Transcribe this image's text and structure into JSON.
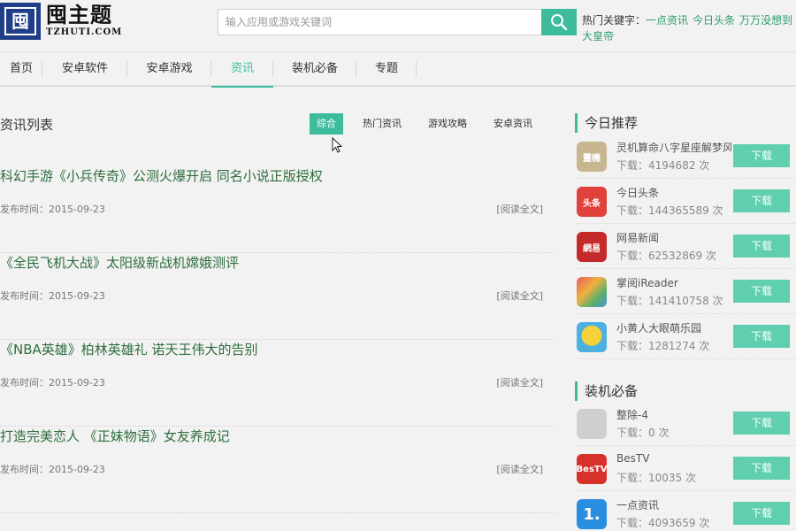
{
  "site": {
    "logo_glyph": "囤",
    "name": "囤主题",
    "domain": "TZHUTI.COM"
  },
  "search": {
    "placeholder": "输入应用或游戏关键词"
  },
  "hot": {
    "label": "热门关键字：",
    "keywords": [
      "一点资讯",
      "今日头条",
      "万万没想到",
      "大皇帝"
    ]
  },
  "nav": [
    "首页",
    "安卓软件",
    "安卓游戏",
    "资讯",
    "装机必备",
    "专题"
  ],
  "nav_active_index": 3,
  "list": {
    "title": "资讯列表",
    "filters": [
      "综合",
      "热门资讯",
      "游戏攻略",
      "安卓资讯"
    ],
    "active_filter": 0,
    "date_prefix": "发布时间：",
    "read_label": "[阅读全文]",
    "articles": [
      {
        "title": "科幻手游《小兵传奇》公测火爆开启 同名小说正版授权",
        "date": "2015-09-23"
      },
      {
        "title": "《全民飞机大战》太阳级新战机嫦娥测评",
        "date": "2015-09-23"
      },
      {
        "title": "《NBA英雄》柏林英雄礼 诺天王伟大的告别",
        "date": "2015-09-23"
      },
      {
        "title": "打造完美恋人 《正妹物语》女友养成记",
        "date": "2015-09-23"
      }
    ]
  },
  "sidebar": {
    "dl_label": "下载：",
    "dl_unit": " 次",
    "button_label": "下载",
    "today": {
      "title": "今日推荐",
      "apps": [
        {
          "name": "灵机算命八字星座解梦风水",
          "downloads": "4194682",
          "icon": "lingji-icon",
          "color": "#c8b690",
          "glyph": "靈機"
        },
        {
          "name": "今日头条",
          "downloads": "144365589",
          "icon": "toutiao-icon",
          "color": "#e0413a",
          "glyph": "头条"
        },
        {
          "name": "网易新闻",
          "downloads": "62532869",
          "icon": "netease-news-icon",
          "color": "#c42a2a",
          "glyph": "網易"
        },
        {
          "name": "掌阅iReader",
          "downloads": "141410758",
          "icon": "ireader-icon",
          "color": "#e37a3a",
          "glyph": ""
        },
        {
          "name": "小黄人大眼萌乐园",
          "downloads": "1281274",
          "icon": "minion-icon",
          "color": "#4cb0e0",
          "glyph": ""
        }
      ]
    },
    "essential": {
      "title": "装机必备",
      "apps": [
        {
          "name": "整除-4",
          "downloads": "0",
          "icon": "placeholder-app-icon",
          "color": "#cfcfcf",
          "glyph": ""
        },
        {
          "name": "BesTV",
          "downloads": "10035",
          "icon": "bestv-icon",
          "color": "#d8302a",
          "glyph": "BesTV"
        },
        {
          "name": "一点资讯",
          "downloads": "4093659",
          "icon": "yidian-icon",
          "color": "#2a8ee0",
          "glyph": "1."
        }
      ]
    }
  }
}
